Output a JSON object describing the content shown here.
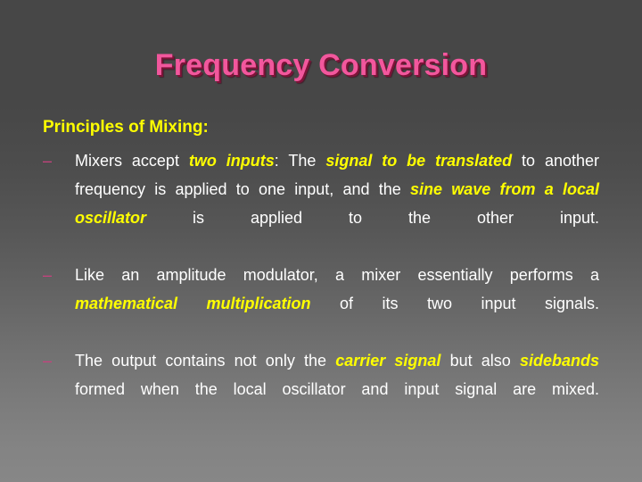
{
  "slide": {
    "title": "Frequency Conversion",
    "heading": "Principles of Mixing:",
    "bullet_marker": "–",
    "colors": {
      "title": "#f2579d",
      "title_shadow": "#7d1338",
      "heading": "#ffff00",
      "emphasis": "#ffff00",
      "body": "#ffffff",
      "bullet_marker": "#c9417f",
      "background_top": "#474747",
      "background_bottom": "#878787"
    },
    "bullets": [
      {
        "marker": "–",
        "runs": [
          {
            "text": "Mixers accept ",
            "style": "plain"
          },
          {
            "text": "two inputs",
            "style": "emphasis"
          },
          {
            "text": ": The ",
            "style": "plain"
          },
          {
            "text": "signal to be translated",
            "style": "emphasis"
          },
          {
            "text": " to another frequency is applied to one input, and the ",
            "style": "plain"
          },
          {
            "text": "sine wave from a local oscillator",
            "style": "emphasis"
          },
          {
            "text": " is applied to the other input.",
            "style": "plain"
          }
        ]
      },
      {
        "marker": "–",
        "runs": [
          {
            "text": "Like an amplitude modulator, a mixer essentially performs a ",
            "style": "plain"
          },
          {
            "text": "mathematical multiplication",
            "style": "emphasis"
          },
          {
            "text": " of its two input signals.",
            "style": "plain"
          }
        ]
      },
      {
        "marker": "–",
        "runs": [
          {
            "text": "The output contains not only the ",
            "style": "plain"
          },
          {
            "text": "carrier signal",
            "style": "emphasis"
          },
          {
            "text": " but also ",
            "style": "plain"
          },
          {
            "text": "sidebands",
            "style": "emphasis"
          },
          {
            "text": " formed when the local oscillator and input signal are mixed.",
            "style": "plain"
          }
        ]
      }
    ]
  }
}
